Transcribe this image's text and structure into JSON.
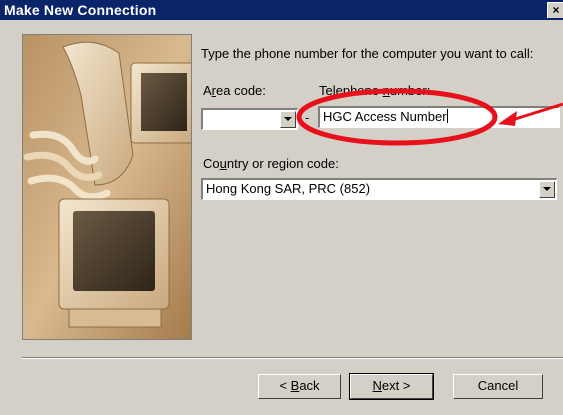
{
  "window": {
    "title": "Make New Connection",
    "close_glyph": "×"
  },
  "content": {
    "instruction": "Type the phone number for the computer you want to call:",
    "area_code_label_pre": "A",
    "area_code_label_mnemonic": "r",
    "area_code_label_post": "ea code:",
    "area_code_value": "",
    "dash": "-",
    "telephone_label_pre": "Telephone ",
    "telephone_label_mnemonic": "n",
    "telephone_label_post": "umber:",
    "telephone_value": "HGC Access Number",
    "country_label_pre": "Co",
    "country_label_mnemonic": "u",
    "country_label_post": "ntry or region code:",
    "country_value": "Hong Kong SAR, PRC (852)"
  },
  "buttons": {
    "back_pre": "< ",
    "back_mnemonic": "B",
    "back_post": "ack",
    "next_mnemonic": "N",
    "next_post": "ext >",
    "cancel": "Cancel"
  },
  "icons": {
    "dropdown": "chevron-down-icon",
    "close": "close-icon",
    "illustration": "computer-phone-illustration"
  },
  "colors": {
    "titlebar": "#0a246a",
    "face": "#d4d0c8",
    "annotation": "#e8101a"
  }
}
